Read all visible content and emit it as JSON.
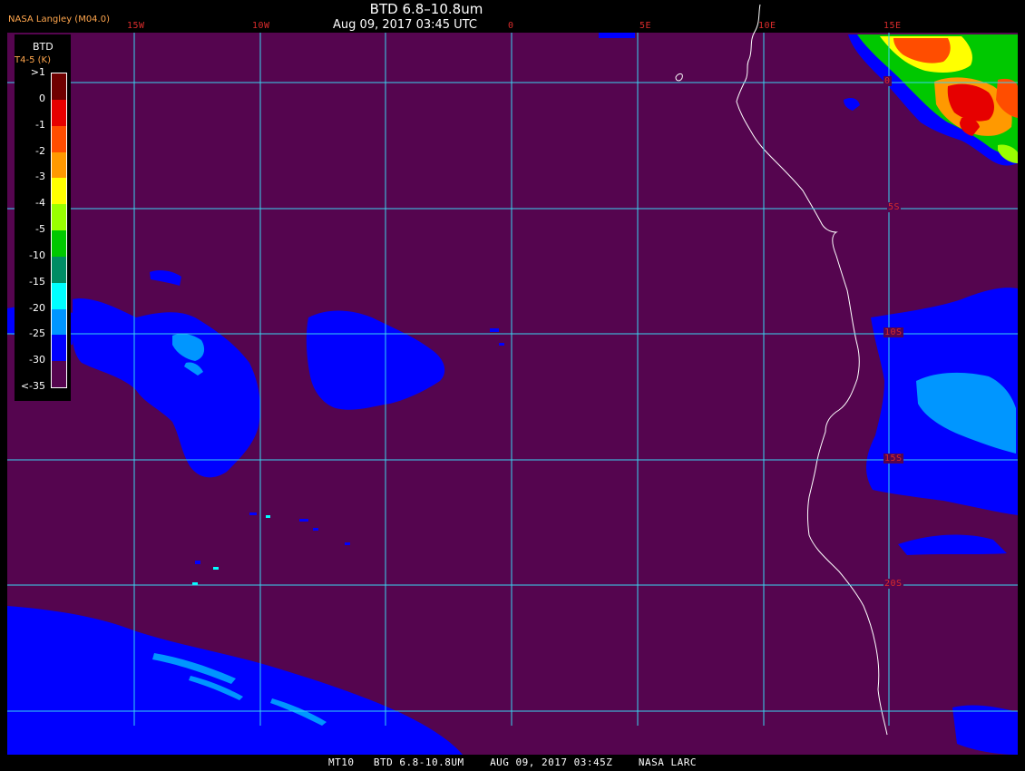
{
  "title": "BTD 6.8–10.8um",
  "subtitle": "Aug 09, 2017 03:45 UTC",
  "producer": "NASA Langley (M04.0)",
  "footer": "MT10   BTD 6.8-10.8UM    AUG 09, 2017 03:45Z    NASA LARC",
  "legend": {
    "title": "BTD",
    "units": "T4-5 (K)",
    "labels": [
      ">1",
      "0",
      "-1",
      "-2",
      "-3",
      "-4",
      "-5",
      "-10",
      "-15",
      "-20",
      "-25",
      "-30",
      "<-35"
    ],
    "colors": [
      "#6e0000",
      "#e60000",
      "#ff4d00",
      "#ff9900",
      "#ffff00",
      "#99ff00",
      "#00c800",
      "#008c64",
      "#00ffff",
      "#0096ff",
      "#0000ff",
      "#55054f"
    ]
  },
  "grid": {
    "longitudes": [
      "15W",
      "10W",
      "0",
      "5E",
      "10E",
      "15E"
    ],
    "latitudes": [
      "0",
      "5S",
      "10S",
      "15S",
      "20S"
    ]
  },
  "colors": {
    "background": "#55054f",
    "grid": "#39d5f0",
    "coast": "#ffffff",
    "cloud_low": "#0000ff",
    "cloud_mid": "#0096ff",
    "lat_lon_label": "#d92b2b"
  }
}
